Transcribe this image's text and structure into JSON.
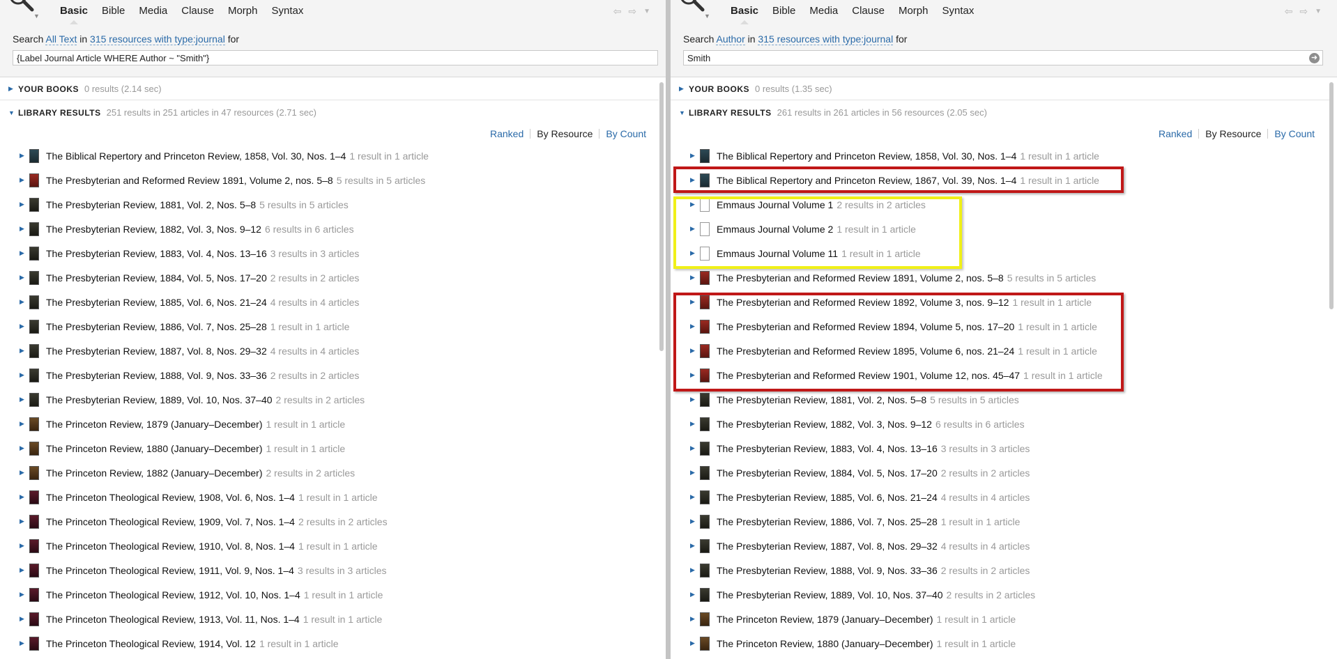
{
  "left": {
    "tabs": [
      "Basic",
      "Bible",
      "Media",
      "Clause",
      "Morph",
      "Syntax"
    ],
    "search": {
      "prefix": "Search",
      "scope": "All Text",
      "in_word": "in",
      "resources": "315 resources with type:journal",
      "suffix": "for"
    },
    "query": "{Label Journal Article WHERE Author ~ \"Smith\"}",
    "your_books": {
      "label": "YOUR BOOKS",
      "meta": "0 results (2.14 sec)"
    },
    "library": {
      "label": "LIBRARY RESULTS",
      "meta": "251 results in 251 articles in 47 resources (2.71 sec)"
    },
    "sort": {
      "ranked": "Ranked",
      "by_resource": "By Resource",
      "by_count": "By Count"
    },
    "rows": [
      {
        "title": "The Biblical Repertory and Princeton Review, 1858, Vol. 30, Nos. 1–4",
        "count": "1 result in 1 article",
        "cover": "teal"
      },
      {
        "title": "The Presbyterian and Reformed Review 1891, Volume 2, nos. 5–8",
        "count": "5 results in 5 articles",
        "cover": "red"
      },
      {
        "title": "The Presbyterian Review, 1881, Vol. 2, Nos. 5–8",
        "count": "5 results in 5 articles",
        "cover": "dark"
      },
      {
        "title": "The Presbyterian Review, 1882, Vol. 3, Nos. 9–12",
        "count": "6 results in 6 articles",
        "cover": "dark"
      },
      {
        "title": "The Presbyterian Review, 1883, Vol. 4, Nos. 13–16",
        "count": "3 results in 3 articles",
        "cover": "dark"
      },
      {
        "title": "The Presbyterian Review, 1884, Vol. 5, Nos. 17–20",
        "count": "2 results in 2 articles",
        "cover": "dark"
      },
      {
        "title": "The Presbyterian Review, 1885, Vol. 6, Nos. 21–24",
        "count": "4 results in 4 articles",
        "cover": "dark"
      },
      {
        "title": "The Presbyterian Review, 1886, Vol. 7, Nos. 25–28",
        "count": "1 result in 1 article",
        "cover": "dark"
      },
      {
        "title": "The Presbyterian Review, 1887, Vol. 8, Nos. 29–32",
        "count": "4 results in 4 articles",
        "cover": "dark"
      },
      {
        "title": "The Presbyterian Review, 1888, Vol. 9, Nos. 33–36",
        "count": "2 results in 2 articles",
        "cover": "dark"
      },
      {
        "title": "The Presbyterian Review, 1889, Vol. 10, Nos. 37–40",
        "count": "2 results in 2 articles",
        "cover": "dark"
      },
      {
        "title": "The Princeton Review, 1879 (January–December)",
        "count": "1 result in 1 article",
        "cover": "brown"
      },
      {
        "title": "The Princeton Review, 1880 (January–December)",
        "count": "1 result in 1 article",
        "cover": "brown"
      },
      {
        "title": "The Princeton Review, 1882 (January–December)",
        "count": "2 results in 2 articles",
        "cover": "brown"
      },
      {
        "title": "The Princeton Theological Review, 1908, Vol. 6, Nos. 1–4",
        "count": "1 result in 1 article",
        "cover": "maroon"
      },
      {
        "title": "The Princeton Theological Review, 1909, Vol. 7, Nos. 1–4",
        "count": "2 results in 2 articles",
        "cover": "maroon"
      },
      {
        "title": "The Princeton Theological Review, 1910, Vol. 8, Nos. 1–4",
        "count": "1 result in 1 article",
        "cover": "maroon"
      },
      {
        "title": "The Princeton Theological Review, 1911, Vol. 9, Nos. 1–4",
        "count": "3 results in 3 articles",
        "cover": "maroon"
      },
      {
        "title": "The Princeton Theological Review, 1912, Vol. 10, Nos. 1–4",
        "count": "1 result in 1 article",
        "cover": "maroon"
      },
      {
        "title": "The Princeton Theological Review, 1913, Vol. 11, Nos. 1–4",
        "count": "1 result in 1 article",
        "cover": "maroon"
      },
      {
        "title": "The Princeton Theological Review, 1914, Vol. 12",
        "count": "1 result in 1 article",
        "cover": "maroon"
      }
    ]
  },
  "right": {
    "tabs": [
      "Basic",
      "Bible",
      "Media",
      "Clause",
      "Morph",
      "Syntax"
    ],
    "search": {
      "prefix": "Search",
      "scope": "Author",
      "in_word": "in",
      "resources": "315 resources with type:journal",
      "suffix": "for"
    },
    "query": "Smith",
    "your_books": {
      "label": "YOUR BOOKS",
      "meta": "0 results (1.35 sec)"
    },
    "library": {
      "label": "LIBRARY RESULTS",
      "meta": "261 results in 261 articles in 56 resources (2.05 sec)"
    },
    "sort": {
      "ranked": "Ranked",
      "by_resource": "By Resource",
      "by_count": "By Count"
    },
    "rows": [
      {
        "title": "The Biblical Repertory and Princeton Review, 1858, Vol. 30, Nos. 1–4",
        "count": "1 result in 1 article",
        "cover": "teal"
      },
      {
        "title": "The Biblical Repertory and Princeton Review, 1867, Vol. 39, Nos. 1–4",
        "count": "1 result in 1 article",
        "cover": "teal"
      },
      {
        "title": "Emmaus Journal Volume 1",
        "count": "2 results in 2 articles",
        "cover": "white"
      },
      {
        "title": "Emmaus Journal Volume 2",
        "count": "1 result in 1 article",
        "cover": "white"
      },
      {
        "title": "Emmaus Journal Volume 11",
        "count": "1 result in 1 article",
        "cover": "white"
      },
      {
        "title": "The Presbyterian and Reformed Review 1891, Volume 2, nos. 5–8",
        "count": "5 results in 5 articles",
        "cover": "red"
      },
      {
        "title": "The Presbyterian and Reformed Review 1892, Volume 3, nos. 9–12",
        "count": "1 result in 1 article",
        "cover": "red"
      },
      {
        "title": "The Presbyterian and Reformed Review 1894, Volume 5, nos. 17–20",
        "count": "1 result in 1 article",
        "cover": "red"
      },
      {
        "title": "The Presbyterian and Reformed Review 1895, Volume 6, nos. 21–24",
        "count": "1 result in 1 article",
        "cover": "red"
      },
      {
        "title": "The Presbyterian and Reformed Review 1901, Volume 12, nos. 45–47",
        "count": "1 result in 1 article",
        "cover": "red"
      },
      {
        "title": "The Presbyterian Review, 1881, Vol. 2, Nos. 5–8",
        "count": "5 results in 5 articles",
        "cover": "dark"
      },
      {
        "title": "The Presbyterian Review, 1882, Vol. 3, Nos. 9–12",
        "count": "6 results in 6 articles",
        "cover": "dark"
      },
      {
        "title": "The Presbyterian Review, 1883, Vol. 4, Nos. 13–16",
        "count": "3 results in 3 articles",
        "cover": "dark"
      },
      {
        "title": "The Presbyterian Review, 1884, Vol. 5, Nos. 17–20",
        "count": "2 results in 2 articles",
        "cover": "dark"
      },
      {
        "title": "The Presbyterian Review, 1885, Vol. 6, Nos. 21–24",
        "count": "4 results in 4 articles",
        "cover": "dark"
      },
      {
        "title": "The Presbyterian Review, 1886, Vol. 7, Nos. 25–28",
        "count": "1 result in 1 article",
        "cover": "dark"
      },
      {
        "title": "The Presbyterian Review, 1887, Vol. 8, Nos. 29–32",
        "count": "4 results in 4 articles",
        "cover": "dark"
      },
      {
        "title": "The Presbyterian Review, 1888, Vol. 9, Nos. 33–36",
        "count": "2 results in 2 articles",
        "cover": "dark"
      },
      {
        "title": "The Presbyterian Review, 1889, Vol. 10, Nos. 37–40",
        "count": "2 results in 2 articles",
        "cover": "dark"
      },
      {
        "title": "The Princeton Review, 1879 (January–December)",
        "count": "1 result in 1 article",
        "cover": "brown"
      },
      {
        "title": "The Princeton Review, 1880 (January–December)",
        "count": "1 result in 1 article",
        "cover": "brown"
      }
    ]
  },
  "colors": {
    "link": "#2a6aa8",
    "highlight_red": "#c01818",
    "highlight_yellow": "#f0f018"
  },
  "icons": {
    "search": "magnifier-icon",
    "back": "arrow-left-icon",
    "forward": "arrow-right-icon",
    "menu": "chevron-down-icon",
    "go": "arrow-circle-icon"
  }
}
